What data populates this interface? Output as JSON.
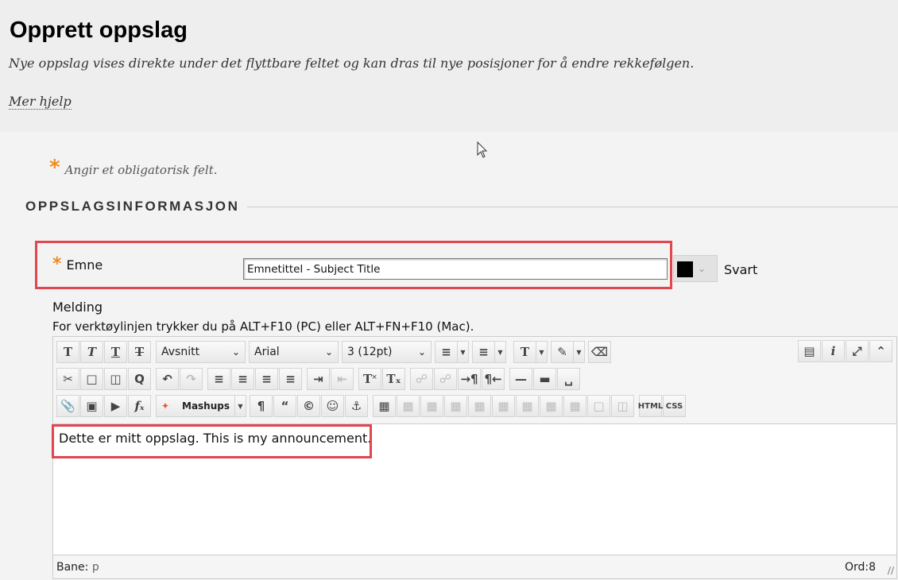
{
  "header": {
    "title": "Opprett oppslag",
    "subtitle": "Nye oppslag vises direkte under det flyttbare feltet og kan dras til nye posisjoner for å endre rekkefølgen.",
    "help_link": "Mer hjelp"
  },
  "required_note": {
    "star": "*",
    "text": "Angir et obligatorisk felt."
  },
  "section": {
    "heading": "OPPSLAGSINFORMASJON"
  },
  "subject": {
    "star": "*",
    "label": "Emne",
    "value": "Emnetittel - Subject Title",
    "color_value": "#000000",
    "color_label": "Svart"
  },
  "message": {
    "label": "Melding",
    "toolbar_hint": "For verktøylinjen trykker du på ALT+F10 (PC) eller ALT+FN+F10 (Mac).",
    "paragraph_select": "Avsnitt",
    "font_select": "Arial",
    "size_select": "3 (12pt)",
    "mashups_label": "Mashups",
    "html_label": "HTML",
    "css_label": "CSS",
    "content": "Dette er mitt oppslag. This is my announcement.",
    "path_label": "Bane:",
    "path_value": "p",
    "word_count": "Ord:8"
  },
  "colors": {
    "highlight_border": "#e0474f",
    "required_star": "#f08c1e"
  }
}
